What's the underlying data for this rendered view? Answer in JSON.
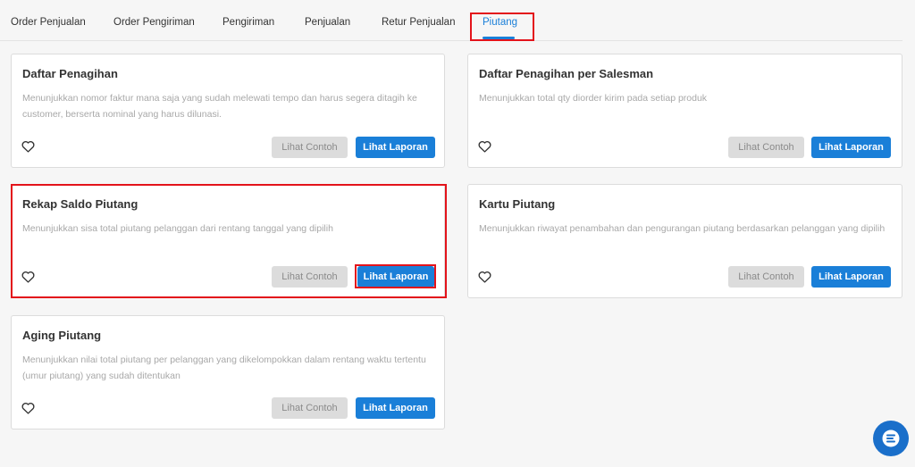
{
  "tabs": [
    {
      "label": "Order Penjualan"
    },
    {
      "label": "Order Pengiriman"
    },
    {
      "label": "Pengiriman"
    },
    {
      "label": "Penjualan"
    },
    {
      "label": "Retur Penjualan"
    },
    {
      "label": "Piutang",
      "active": true
    }
  ],
  "cards": [
    {
      "title": "Daftar Penagihan",
      "description": "Menunjukkan nomor faktur mana saja yang sudah melewati tempo dan harus segera ditagih ke customer, berserta nominal yang harus dilunasi.",
      "example_label": "Lihat Contoh",
      "report_label": "Lihat Laporan"
    },
    {
      "title": "Daftar Penagihan per Salesman",
      "description": "Menunjukkan total qty diorder kirim pada setiap produk",
      "example_label": "Lihat Contoh",
      "report_label": "Lihat Laporan"
    },
    {
      "title": "Rekap Saldo Piutang",
      "description": "Menunjukkan sisa total piutang pelanggan dari rentang tanggal yang dipilih",
      "example_label": "Lihat Contoh",
      "report_label": "Lihat Laporan",
      "highlighted": true
    },
    {
      "title": "Kartu Piutang",
      "description": "Menunjukkan riwayat penambahan dan pengurangan piutang berdasarkan pelanggan yang dipilih",
      "example_label": "Lihat Contoh",
      "report_label": "Lihat Laporan"
    },
    {
      "title": "Aging Piutang",
      "description": "Menunjukkan nilai total piutang per pelanggan yang dikelompokkan dalam rentang waktu tertentu (umur piutang) yang sudah ditentukan",
      "example_label": "Lihat Contoh",
      "report_label": "Lihat Laporan"
    }
  ],
  "icons": {
    "favorite": "heart-icon",
    "chat": "chat-icon"
  },
  "colors": {
    "accent": "#1a7fd8",
    "highlight": "#e3131b",
    "chat": "#1a6fca"
  }
}
